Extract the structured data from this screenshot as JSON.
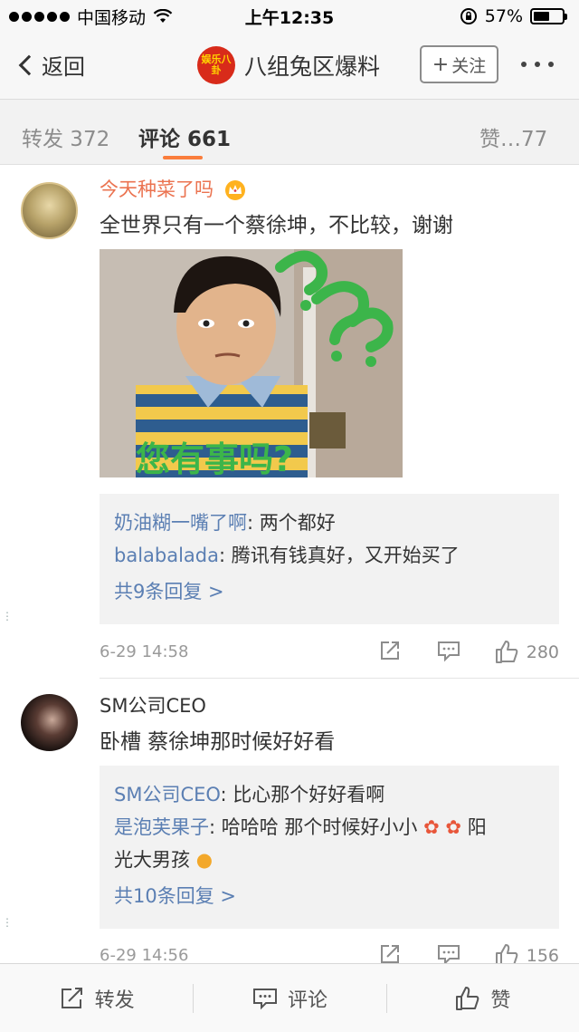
{
  "status_bar": {
    "carrier": "中国移动",
    "time": "上午12:35",
    "battery_percent": "57%",
    "battery_level": 0.57,
    "icons": [
      "signal-icon",
      "wifi-icon",
      "rotation-lock-icon",
      "battery-icon"
    ]
  },
  "nav": {
    "back_label": "返回",
    "title": "八组兔区爆料",
    "logo_text": "娱乐八卦",
    "follow_label": "关注",
    "follow_icon": "plus-icon",
    "more_icon": "more-dots-icon"
  },
  "tabs": {
    "repost": "转发 372",
    "comments": "评论 661",
    "likes": "赞…77",
    "accent_color": "#fa7d3c"
  },
  "comments": [
    {
      "user": "今天种菜了吗",
      "badge_icon": "crown-icon",
      "text": "全世界只有一个蔡徐坤，不比较，谢谢",
      "image_caption": "您有事吗?",
      "replies": [
        {
          "name": "奶油糊一嘴了啊",
          "text": ": 两个都好"
        },
        {
          "name": "balabalada",
          "text": ": 腾讯有钱真好，又开始买了"
        }
      ],
      "more_replies": "共9条回复 >",
      "time": "6-29 14:58",
      "likes": "280"
    },
    {
      "user": "SM公司CEO",
      "text": "卧槽 蔡徐坤那时候好好看",
      "replies": [
        {
          "name": "SM公司CEO",
          "text": ": 比心那个好好看啊"
        },
        {
          "name": "是泡芙果子",
          "text": ": 哈哈哈  那个时候好小小",
          "text_cont": "光大男孩"
        }
      ],
      "reply_emoji_text": "阳",
      "more_replies": "共10条回复 >",
      "time": "6-29 14:56",
      "likes": "156"
    }
  ],
  "toolbar": {
    "repost": "转发",
    "comment": "评论",
    "like": "赞"
  },
  "colors": {
    "link_blue": "#5b7fb3",
    "username_orange": "#eb7350",
    "tab_accent": "#fa7d3c"
  }
}
